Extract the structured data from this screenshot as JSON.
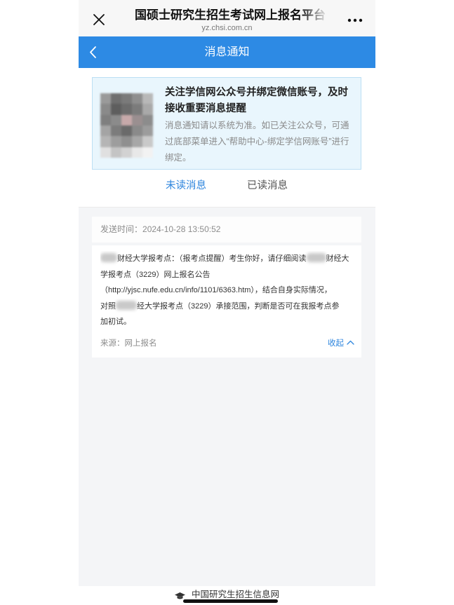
{
  "theme": {
    "accent": "#2d8ae4",
    "link": "#2f86de",
    "notice_bg": "#e9f6fd",
    "page_bg": "#f4f5f7"
  },
  "browser": {
    "close_icon": "close-icon",
    "title": "国硕士研究生招生考试网上报名平台",
    "domain": "yz.chsi.com.cn",
    "more_icon": "more-icon"
  },
  "header": {
    "back_icon": "chevron-left-icon",
    "title": "消息通知"
  },
  "notice": {
    "image_icon": "qr-code-image",
    "title_lines": [
      "关注学信网公众号并绑定微信账号，及时",
      "接收重要消息提醒"
    ],
    "desc_lines": [
      "消息通知请以系统为准。如已关注公众号，可通",
      "过底部菜单进入“帮助中心-绑定学信网账号”进行",
      "绑定。"
    ]
  },
  "tabs": [
    {
      "label": "未读消息",
      "active": true
    },
    {
      "label": "已读消息",
      "active": false
    }
  ],
  "message": {
    "sent_label": "发送时间：",
    "sent_time": "2024-10-28 13:50:52",
    "body_lines": [
      [
        "财经大学报考点：（报考点提醒）考生你好，请仔细阅读",
        "财经大"
      ],
      [
        "学报考点（3229）网上报名公告"
      ],
      [
        "（http://yjsc.nufe.edu.cn/info/1101/6363.htm），结合自身实际情况，"
      ],
      [
        "对照",
        "经大学报考点（3229）承接范围，判断是否可在我报考点参"
      ],
      [
        "加初试。"
      ]
    ],
    "source_label": "来源：",
    "source": "网上报名",
    "collapse_label": "收起",
    "collapse_icon": "chevron-up-icon"
  },
  "footer": {
    "logo_icon": "graduation-cap-icon",
    "site_name": "中国研究生招生信息网"
  }
}
